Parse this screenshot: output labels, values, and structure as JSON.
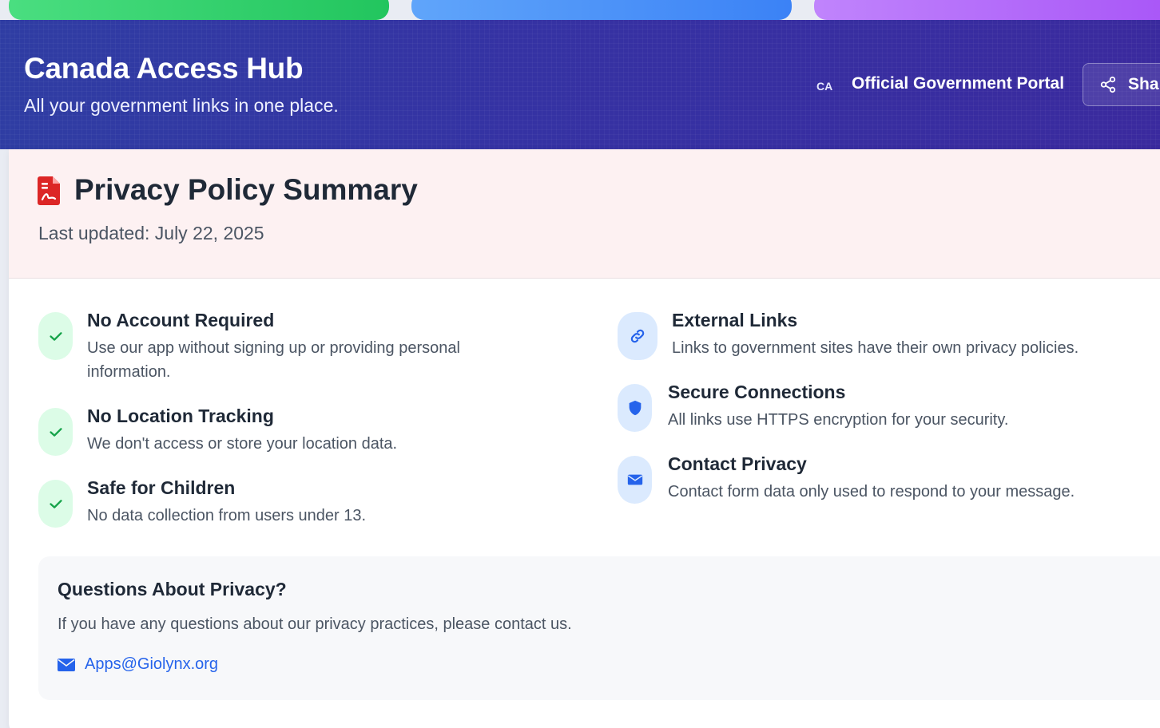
{
  "header": {
    "title": "Canada Access Hub",
    "subtitle": "All your government links in one place.",
    "country_code": "CA",
    "portal_label": "Official Government Portal",
    "share_label": "Sha"
  },
  "privacy": {
    "title": "Privacy Policy Summary",
    "updated": "Last updated: July 22, 2025",
    "left_items": [
      {
        "title": "No Account Required",
        "desc": "Use our app without signing up or providing personal information.",
        "icon": "check-icon"
      },
      {
        "title": "No Location Tracking",
        "desc": "We don't access or store your location data.",
        "icon": "check-icon"
      },
      {
        "title": "Safe for Children",
        "desc": "No data collection from users under 13.",
        "icon": "check-icon"
      }
    ],
    "right_items": [
      {
        "title": "External Links",
        "desc": "Links to government sites have their own privacy policies.",
        "icon": "link-icon"
      },
      {
        "title": "Secure Connections",
        "desc": "All links use HTTPS encryption for your security.",
        "icon": "shield-icon"
      },
      {
        "title": "Contact Privacy",
        "desc": "Contact form data only used to respond to your message.",
        "icon": "envelope-icon"
      }
    ],
    "questions": {
      "title": "Questions About Privacy?",
      "desc": "If you have any questions about our privacy practices, please contact us.",
      "email": "Apps@Giolynx.org"
    }
  },
  "colors": {
    "header_start": "#2f3da3",
    "header_end": "#3a2a9e",
    "accent_blue": "#2563eb",
    "success_green": "#16a34a",
    "pdf_red": "#dc2626"
  }
}
